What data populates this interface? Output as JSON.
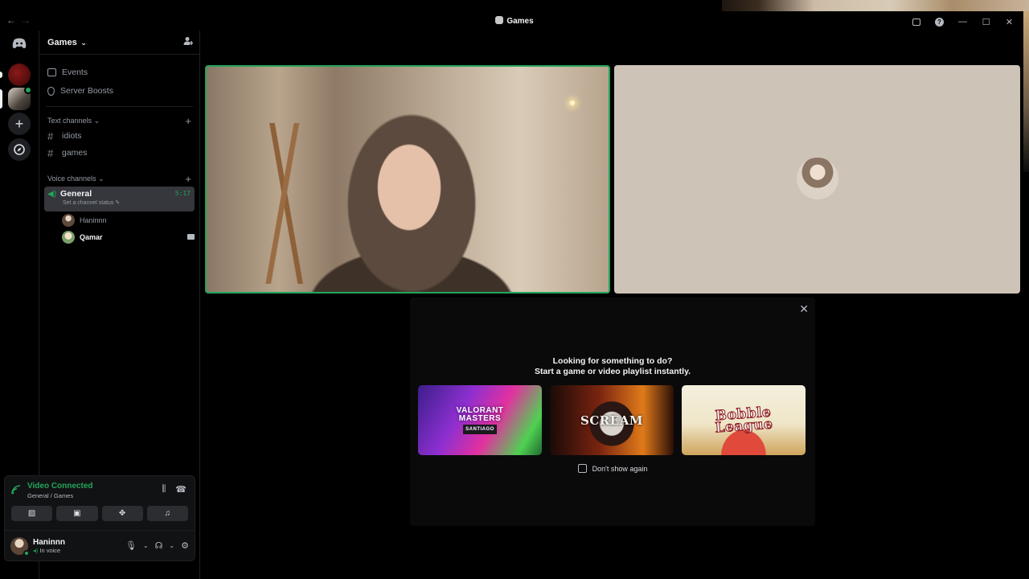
{
  "window": {
    "title": "Games"
  },
  "guild": {
    "name": "Games"
  },
  "nav": [
    {
      "label": "Events",
      "icon": "calendar-icon"
    },
    {
      "label": "Server Boosts",
      "icon": "shield-icon"
    }
  ],
  "categories": {
    "text": "Text channels",
    "voice": "Voice channels"
  },
  "text_channels": [
    "idiots",
    "games"
  ],
  "voice_channel": {
    "name": "General",
    "timer": "5:17",
    "status_placeholder": "Set a channel status"
  },
  "members": [
    {
      "name": "Haninnn",
      "bold": false,
      "camera": false
    },
    {
      "name": "Qamar",
      "bold": true,
      "camera": true
    }
  ],
  "voice_panel": {
    "title": "Video Connected",
    "subtitle": "General / Games"
  },
  "user": {
    "name": "Haninnn",
    "status": "In voice"
  },
  "activity": {
    "line1": "Looking for something to do?",
    "line2": "Start a game or video playlist instantly.",
    "cards": [
      {
        "title": "VALORANT MASTERS",
        "subtitle": "SANTIAGO"
      },
      {
        "title": "SCREAM"
      },
      {
        "title": "Bobble League"
      }
    ],
    "checkbox_label": "Don't show again"
  },
  "colors": {
    "accent_green": "#23a55a",
    "background": "#000000",
    "panel": "#111214"
  }
}
